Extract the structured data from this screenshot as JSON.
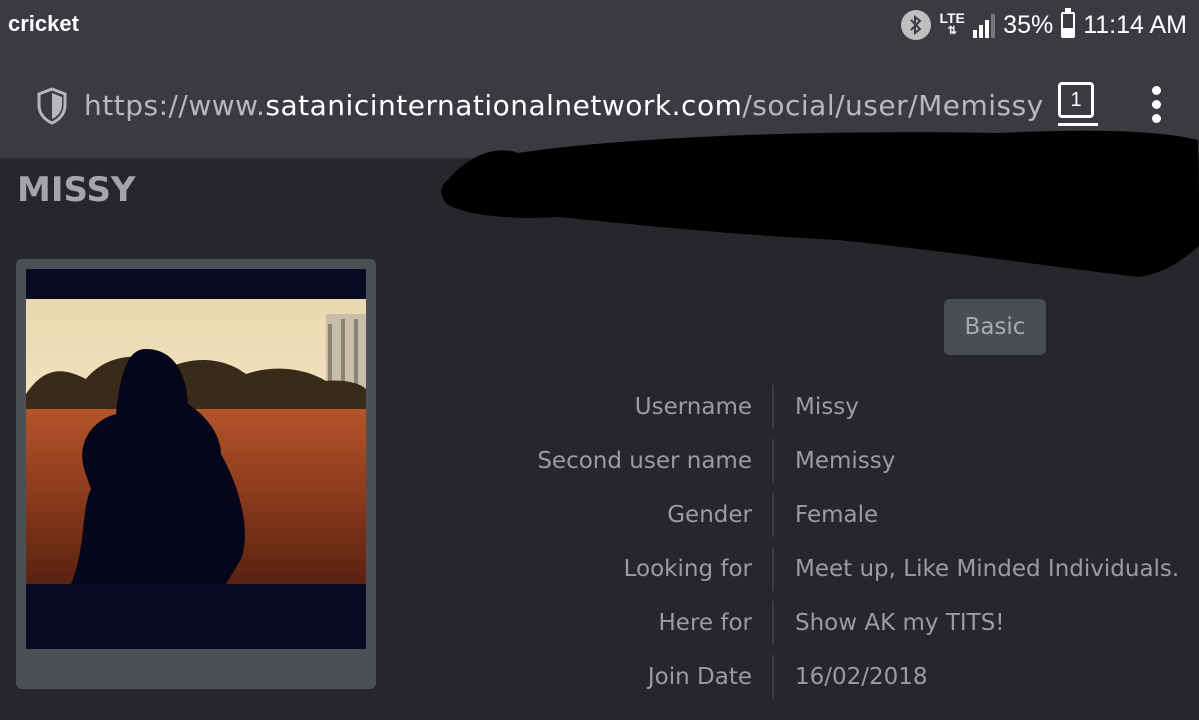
{
  "status_bar": {
    "carrier": "cricket",
    "network": "LTE",
    "battery_percent": "35%",
    "battery_level": 0.35,
    "time": "11:14 AM",
    "icons": [
      "bluetooth-icon",
      "lte-icon",
      "signal-icon",
      "battery-icon"
    ]
  },
  "browser": {
    "url_prefix": "https://www.",
    "url_domain": "satanicinternationalnetwork.com",
    "url_path": "/social/user/Memissy",
    "tab_count": "1"
  },
  "profile": {
    "title": "MISSY",
    "tab_button": "Basic",
    "fields": [
      {
        "label": "Username",
        "value": "Missy"
      },
      {
        "label": "Second user name",
        "value": "Memissy"
      },
      {
        "label": "Gender",
        "value": "Female"
      },
      {
        "label": "Looking for",
        "value": "Meet up, Like Minded Individuals."
      },
      {
        "label": "Here for",
        "value": "Show AK my TITS!"
      },
      {
        "label": "Join Date",
        "value": "16/02/2018"
      }
    ]
  },
  "colors": {
    "background": "#25272b",
    "toolbar": "#3a3b40",
    "text": "#9a9ca0"
  }
}
